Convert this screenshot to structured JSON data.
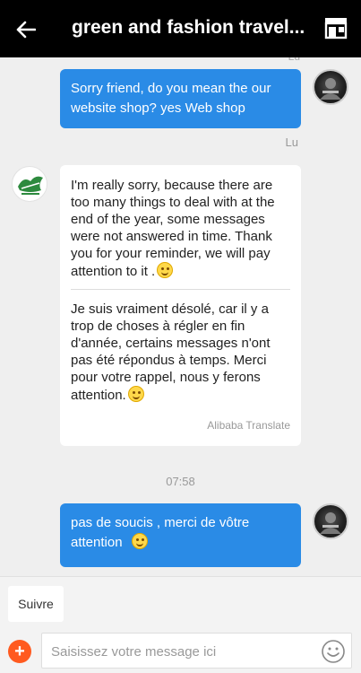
{
  "header": {
    "title": "green and fashion travel...",
    "back_icon": "arrow-left-icon",
    "shop_icon": "store-icon"
  },
  "chat": {
    "top_sender_partial": "Lu",
    "messages": [
      {
        "direction": "outgoing",
        "text": "Sorry friend, do you mean the our website shop?      yes Web shop",
        "sender": "Lu"
      },
      {
        "direction": "incoming",
        "original_text": "I'm really sorry, because there are too many things to deal with at the end of the year, some messages were not answered in time. Thank you for your reminder, we will pay attention to it .",
        "translated_text": "Je suis vraiment désolé, car il y a trop de choses à régler en fin d'année, certains messages n'ont pas été répondus à temps. Merci pour votre rappel, nous y ferons attention.",
        "translate_label": "Alibaba Translate"
      },
      {
        "direction": "time",
        "text": "07:58"
      },
      {
        "direction": "outgoing",
        "text": "pas de soucis  , merci de vôtre attention"
      }
    ]
  },
  "composer": {
    "quick_reply": "Suivre",
    "placeholder": "Saisissez votre message ici",
    "value": "",
    "plus_icon": "plus-icon",
    "emoji_icon": "emoji-icon"
  },
  "colors": {
    "header_bg": "#000000",
    "outgoing_bubble": "#2a8be6",
    "incoming_bubble": "#ffffff",
    "plus_button": "#ff5a1f"
  }
}
